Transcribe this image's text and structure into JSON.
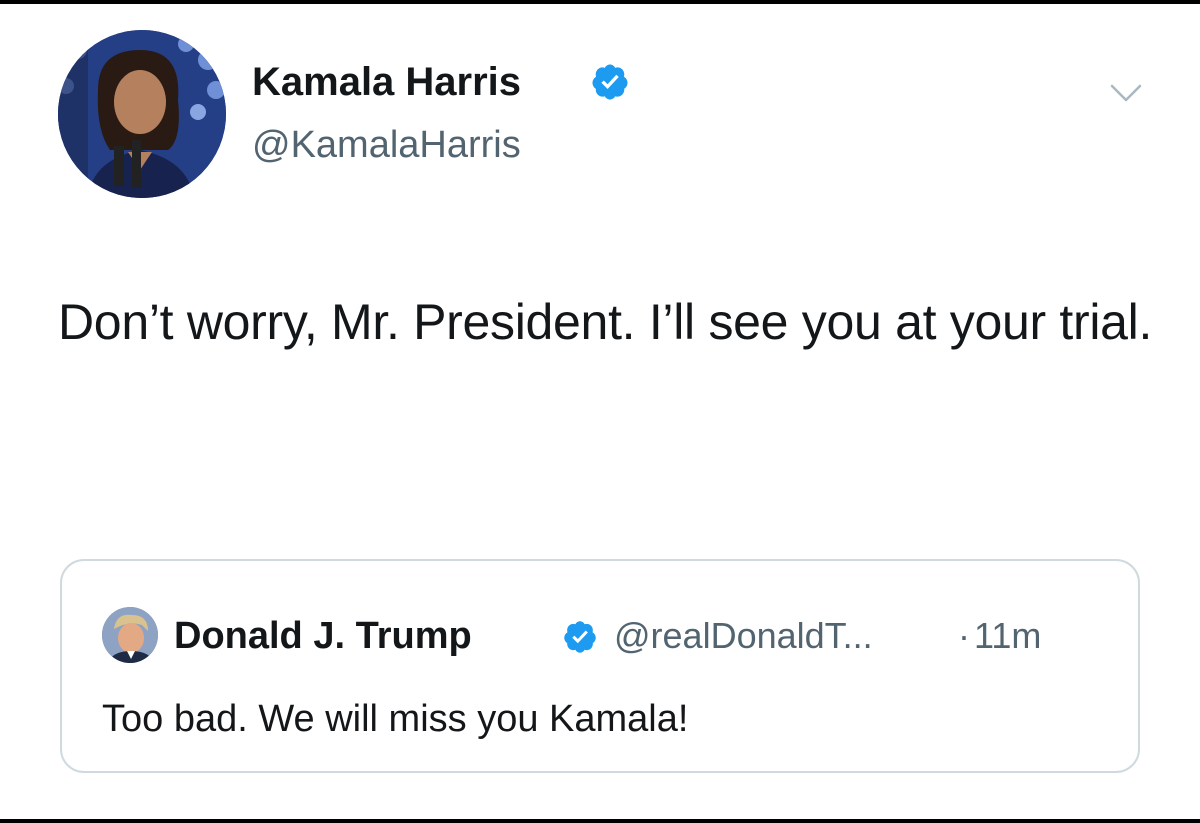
{
  "tweet": {
    "author": {
      "name": "Kamala Harris",
      "handle": "@KamalaHarris",
      "avatar_icon": "profile-photo",
      "verified": true
    },
    "text": "Don’t worry, Mr. President. I’ll see you at your trial.",
    "more_icon": "chevron-down-icon",
    "quoted": {
      "author": {
        "name": "Donald J. Trump",
        "handle": "@realDonaldT...",
        "avatar_icon": "profile-photo",
        "verified": true
      },
      "separator": "·",
      "time": "11m",
      "text": "Too bad. We will miss you Kamala!"
    }
  },
  "colors": {
    "verified": "#1d9bf0",
    "text_primary": "#14171a",
    "text_secondary": "#536471",
    "card_border": "#cfd9de",
    "frame": "#000000"
  }
}
